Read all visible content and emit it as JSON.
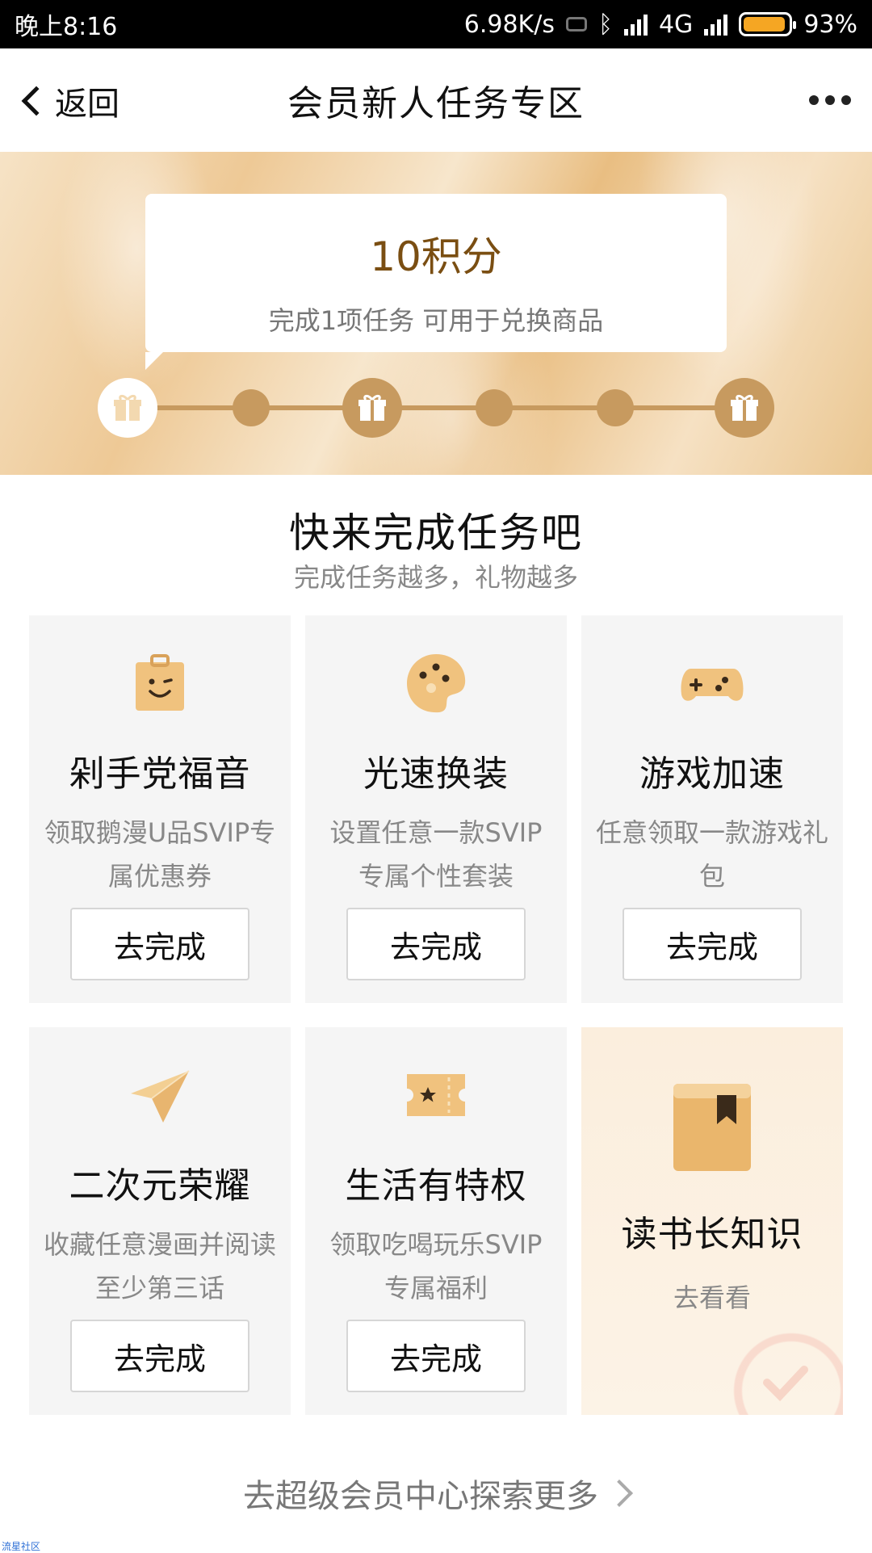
{
  "status_bar": {
    "time": "晚上8:16",
    "network_speed": "6.98K/s",
    "network_type": "4G",
    "battery_percent": "93%",
    "battery_level": 0.93,
    "icons": [
      "vibrate-icon",
      "bluetooth-icon",
      "signal-icon",
      "battery-icon"
    ]
  },
  "nav": {
    "back_label": "返回",
    "title": "会员新人任务专区"
  },
  "banner": {
    "points": "10积分",
    "description": "完成1项任务 可用于兑换商品",
    "progress_nodes": [
      "gift",
      "dot",
      "gift",
      "dot",
      "dot",
      "gift"
    ],
    "completed_nodes": 1
  },
  "section": {
    "title": "快来完成任务吧",
    "subtitle": "完成任务越多，礼物越多"
  },
  "tasks": [
    {
      "icon": "shopping-bag-icon",
      "title": "剁手党福音",
      "desc": "领取鹅漫U品SVIP专属优惠券",
      "button": "去完成"
    },
    {
      "icon": "palette-icon",
      "title": "光速换装",
      "desc": "设置任意一款SVIP专属个性套装",
      "button": "去完成"
    },
    {
      "icon": "gamepad-icon",
      "title": "游戏加速",
      "desc": "任意领取一款游戏礼包",
      "button": "去完成"
    },
    {
      "icon": "paper-plane-icon",
      "title": "二次元荣耀",
      "desc": "收藏任意漫画并阅读至少第三话",
      "button": "去完成"
    },
    {
      "icon": "ticket-icon",
      "title": "生活有特权",
      "desc": "领取吃喝玩乐SVIP专属福利",
      "button": "去完成"
    }
  ],
  "feature_task": {
    "icon": "book-icon",
    "title": "读书长知识",
    "link": "去看看"
  },
  "footer": {
    "link": "去超级会员中心探索更多"
  },
  "watermark": "流星社区",
  "colors": {
    "accent_gold": "#c79a5f",
    "points_brown": "#7a4e12",
    "battery_orange": "#f5a623"
  }
}
